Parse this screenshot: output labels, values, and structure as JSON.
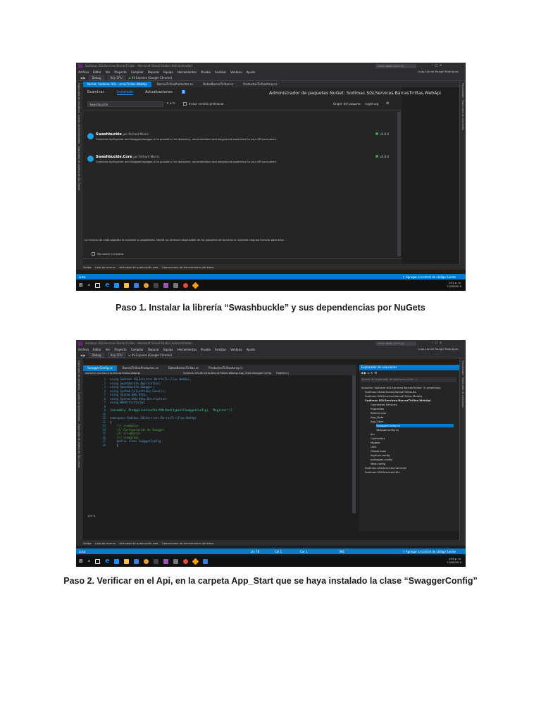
{
  "figure1": {
    "window_title": "Sodimac.SGLServices.BarrasTirillas - Microsoft Visual Studio (Administrador)",
    "quick_launch": "Inicio rápido (Ctrl+Q)",
    "user": "Luigui Javier Rangel Rodriguez",
    "menu": [
      "Archivo",
      "Editar",
      "Ver",
      "Proyecto",
      "Compilar",
      "Depurar",
      "Equipo",
      "Herramientas",
      "Prueba",
      "Analizar",
      "Ventana",
      "Ayuda"
    ],
    "toolbar": {
      "config": "Debug",
      "platform": "Any CPU",
      "run": "IIS Express (Google Chrome)"
    },
    "left_strip": [
      "Explorador de servidores",
      "Cuadro de herramientas",
      "Explorador de objetos de SQL Server"
    ],
    "right_strip": [
      "Propiedades",
      "Explorador de soluciones"
    ],
    "doc_tabs": [
      "NuGet: Sodimac.SGL...arrasTirillas.WebApi",
      "BarrasTirillasProductos.cs",
      "DatosBarrasTirillas.cs",
      "ProductosTirillasArray.cs"
    ],
    "nuget": {
      "tabs": [
        "Examinar",
        "Instalado",
        "Actualizaciones"
      ],
      "updates_count": "1",
      "header": "Administrador de paquetes NuGet: Sodimac.SGLServices.BarrasTirillas.WebApi",
      "search_value": "Swashbuckle",
      "prerelease_label": "Incluir versión preliminar",
      "source_label": "Origen del paquete:",
      "source_value": "nuget.org",
      "packages": [
        {
          "name": "Swashbuckle",
          "author": "por Richard Morris",
          "version": "v5.6.0",
          "description": "Combines ApiExplorer and Swagger/swagger-ui to provide a rich discovery, documentation and playground experience to your API consumers."
        },
        {
          "name": "Swashbuckle.Core",
          "author": "por Richard Morris",
          "version": "v5.6.0",
          "description": "Combines ApiExplorer and Swagger/swagger-ui to provide a rich discovery, documentation and playground experience to your API consumers."
        }
      ],
      "license_text": "La licencia de cada paquete la concede su propietario. NuGet no se hace responsable de los paquetes de terceros ni concede ninguna licencia para ellos.",
      "no_show_label": "No volver a mostrar"
    },
    "output_tabs": [
      "Salida",
      "Lista de errores",
      "Actividad de publicación web",
      "Operaciones de herramientas de datos"
    ],
    "status": {
      "left": "Listo",
      "right": "Agregar al control de código fuente"
    },
    "tray": {
      "time": "3:52 p. m.",
      "date": "12/06/2019"
    }
  },
  "figure2": {
    "window_title": "Sodimac.SGLServices.BarrasTirillas - Microsoft Visual Studio (Administrador)",
    "quick_launch": "Inicio rápido (Ctrl+Q)",
    "user": "Luigui Javier Rangel Rodriguez",
    "menu": [
      "Archivo",
      "Editar",
      "Ver",
      "Proyecto",
      "Compilar",
      "Depurar",
      "Equipo",
      "Herramientas",
      "Prueba",
      "Analizar",
      "Ventana",
      "Ayuda"
    ],
    "toolbar": {
      "config": "Debug",
      "platform": "Any CPU",
      "run": "IIS Express (Google Chrome)"
    },
    "doc_tabs": [
      "SwaggerConfig.cs",
      "BarrasTirillasProductos.cs",
      "DatosBarrasTirillas.cs",
      "ProductosTirillasArray.cs"
    ],
    "nav_bar": {
      "project": "Sodimac.SGLServices.BarrasTirillas.WebApi",
      "class": "Sodimac.SGLServices.BarrasTirillas.WebApi.App_Start.SwaggerConfig",
      "member": "Register()"
    },
    "code": {
      "line_numbers": [
        "1",
        "2",
        "3",
        "4",
        "5",
        "6",
        "7",
        "8",
        "9",
        "10",
        "11",
        "12",
        "13",
        "14",
        "15",
        "16",
        "17",
        "18"
      ],
      "lines": [
        "using Sodimac.SGLServices.BarrasTirillas.WebApi;",
        "using Swashbuckle.Application;",
        "using Swashbuckle.Swagger;",
        "using System.Collections.Generic;",
        "using System.Web.Http;",
        "using System.Web.Http.Description;",
        "using WebActivatorEx;",
        "",
        "[assembly: PreApplicationStartMethod(typeof(SwaggerConfig), \"Register\")]",
        "",
        "namespace Sodimac.SGLServices.BarrasTirillas.WebApi",
        "{",
        "    /// <summary>",
        "    /// Configuración de Swagger",
        "    /// </summary>",
        "    /// <remarks>",
        "    public class SwaggerConfig",
        "    {"
      ]
    },
    "solution_explorer": {
      "title": "Explorador de soluciones",
      "search_placeholder": "Buscar en Explorador de soluciones (Ctrl+ );",
      "items": [
        "Solución 'Sodimac.SGLServices.BarrasTirillas' (5 proyectos)",
        "Sodimac.SGLServices.BarrasTirillas.BL",
        "Sodimac.SGLServices.BarrasTirillas.Models",
        "Sodimac.SGLServices.BarrasTirillas.WebApi",
        "Connected Services",
        "Properties",
        "Referencias",
        "App_Data",
        "App_Start",
        "SwaggerConfig.cs",
        "WebApiConfig.cs",
        "bin",
        "Controllers",
        "Models",
        "Utils",
        "Global.asax",
        "log4net.config",
        "packages.config",
        "Web.config",
        "Sodimac.SGLServices.Common",
        "Sodimac.SGLServices.DAL"
      ]
    },
    "zoom": "100 %",
    "output_tabs": [
      "Salida",
      "Lista de errores",
      "Actividad de publicación web",
      "Operaciones de herramientas de datos"
    ],
    "status": {
      "left": "Listo",
      "ln": "Lín 78",
      "col": "Col 1",
      "car": "Car 1",
      "ins": "INS",
      "right": "Agregar al control de código fuente"
    },
    "tray": {
      "time": "3:56 p. m.",
      "date": "12/06/2019"
    }
  },
  "captions": {
    "step1": "Paso 1. Instalar la librería “Swashbuckle” y sus dependencias por NuGets",
    "step2": "Paso 2. Verificar en el Api, en la carpeta App_Start que se haya instalado la clase “SwaggerConfig”"
  }
}
